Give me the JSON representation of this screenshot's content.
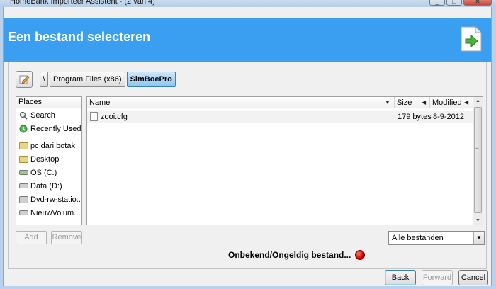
{
  "window": {
    "title": "HomeBank Importeer Assistent - (2 van 4)",
    "controls": [
      "_",
      "□",
      "✕"
    ]
  },
  "banner": {
    "title": "Een bestand selecteren",
    "color": "#3a9ff0"
  },
  "pathbar": {
    "separator": "\\",
    "crumbs": [
      "Program Files (x86)",
      "SimBoePro"
    ],
    "active_crumb": "SimBoePro"
  },
  "places": {
    "header": "Places",
    "items": [
      {
        "label": "Search",
        "icon": "search-icon"
      },
      {
        "label": "Recently Used",
        "icon": "recent-icon"
      },
      {
        "label": "pc dari botak",
        "icon": "folder-icon"
      },
      {
        "label": "Desktop",
        "icon": "folder-icon"
      },
      {
        "label": "OS (C:)",
        "icon": "drive-icon"
      },
      {
        "label": "Data (D:)",
        "icon": "drive-icon"
      },
      {
        "label": "Dvd-rw-statio...",
        "icon": "optical-drive-icon"
      },
      {
        "label": "NieuwVolum...",
        "icon": "drive-icon"
      }
    ]
  },
  "files": {
    "columns": {
      "name": "Name",
      "size": "Size",
      "modified": "Modified"
    },
    "rows": [
      {
        "name": "zooi.cfg",
        "size": "179 bytes",
        "modified": "8-9-2012"
      }
    ]
  },
  "buttons": {
    "add": "Add",
    "remove": "Remove",
    "back": "Back",
    "forward": "Forward",
    "cancel": "Cancel"
  },
  "filter": {
    "value": "Alle bestanden"
  },
  "status": {
    "text": "Onbekend/Ongeldig bestand...",
    "color": "#c90000"
  }
}
